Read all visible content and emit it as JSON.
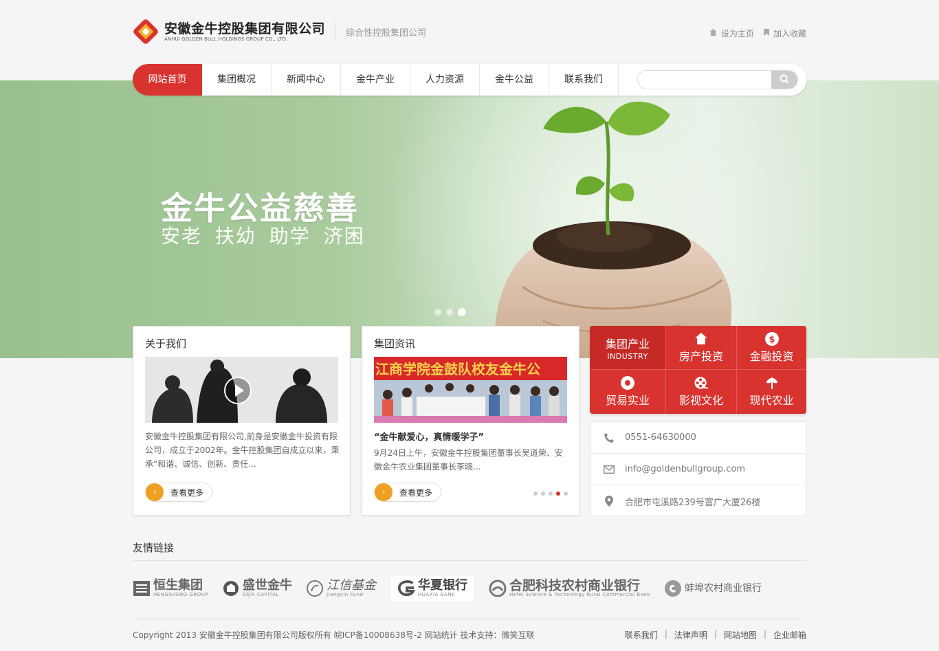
{
  "header": {
    "company_cn": "安徽金牛控股集团有限公司",
    "company_en": "ANHUI GOLDEN BULL HOLDINGS GROUP CO., LTD.",
    "slogan": "综合性控股集团公司",
    "set_home": "设为主页",
    "add_favorite": "加入收藏"
  },
  "nav": {
    "items": [
      "网站首页",
      "集团概况",
      "新闻中心",
      "金牛产业",
      "人力资源",
      "金牛公益",
      "联系我们"
    ],
    "active_index": 0,
    "search_placeholder": ""
  },
  "banner": {
    "title": "金牛公益慈善",
    "subtitle": "安老  扶幼  助学  济困",
    "slide_count": 3,
    "active_slide": 3
  },
  "about": {
    "title": "关于我们",
    "text": "安徽金牛控股集团有限公司,前身是安徽金牛投资有限公司，成立于2002年。金牛控股集团自成立以来，秉承“和谐、诚信、创新、责任...",
    "more": "查看更多"
  },
  "news": {
    "title": "集团资讯",
    "image_banner_text": "江商学院金鼓队校友金牛公",
    "headline": "“金牛献爱心，真情暖学子”",
    "text": "9月24日上午，安徽金牛控股集团董事长吴道荣、安徽金牛农业集团董事长李晓...",
    "more": "查看更多",
    "slide_count": 5,
    "active_slide": 4
  },
  "industry": {
    "first_label": "集团产业",
    "first_en": "INDUSTRY",
    "items": [
      {
        "label": "房产投资",
        "icon": "house-icon"
      },
      {
        "label": "金融投资",
        "icon": "dollar-icon"
      },
      {
        "label": "贸易实业",
        "icon": "record-icon"
      },
      {
        "label": "影视文化",
        "icon": "film-reel-icon"
      },
      {
        "label": "现代农业",
        "icon": "leaf-icon"
      }
    ],
    "accent": "#d9332f"
  },
  "contact": {
    "phone": "0551-64630000",
    "email": "info@goldenbullgroup.com",
    "address": "合肥市屯溪路239号富广大厦26楼"
  },
  "friend_links": {
    "title": "友情链接",
    "partners": [
      {
        "name": "恒生集团",
        "en": "HENGSHENG GROUP"
      },
      {
        "name": "盛世金牛",
        "en": "SSJN CAPITAL"
      },
      {
        "name": "江信基金",
        "en": "Jiangxin Fund"
      },
      {
        "name": "华夏银行",
        "en": "HUAXIA BANK"
      },
      {
        "name": "合肥科技农村商业银行",
        "en": "Hefei Science & Technology Rural Commercial Bank"
      },
      {
        "name": "蚌埠农村商业银行",
        "en": ""
      }
    ]
  },
  "footer": {
    "copyright": "Copyright 2013 安徽金牛控股集团有限公司版权所有 皖ICP备10008638号-2 网站统计 技术支持：微笑互联",
    "links": [
      "联系我们",
      "法律声明",
      "网站地图",
      "企业邮箱"
    ]
  }
}
